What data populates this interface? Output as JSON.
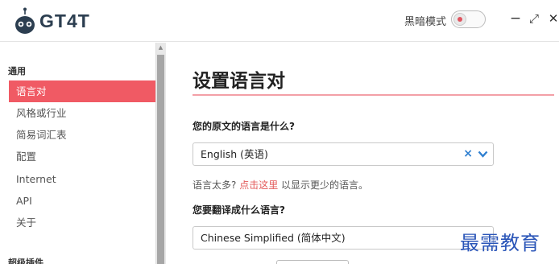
{
  "app": {
    "logo_text": "GT4T"
  },
  "titlebar": {
    "dark_mode_label": "黑暗模式",
    "minimize_glyph": "−",
    "maximize_glyph": "⤢",
    "close_glyph": "✕",
    "accent_color": "#f05a64"
  },
  "sidebar": {
    "group_general": "通用",
    "items": [
      {
        "label": "语言对",
        "active": true
      },
      {
        "label": "风格或行业",
        "active": false
      },
      {
        "label": "简易词汇表",
        "active": false
      },
      {
        "label": "配置",
        "active": false
      },
      {
        "label": "Internet",
        "active": false
      },
      {
        "label": "API",
        "active": false
      },
      {
        "label": "关于",
        "active": false
      }
    ],
    "group_plugins": "超级插件"
  },
  "main": {
    "title": "设置语言对",
    "source_question": "您的原文的语言是什么?",
    "source_value": "English (英语)",
    "hint_prefix": "语言太多?",
    "hint_link": "点击这里",
    "hint_suffix": "以显示更少的语言。",
    "target_question": "您要翻译成什么语言?",
    "target_value": "Chinese Simplified (简体中文)"
  },
  "watermark": {
    "text": "最需教育"
  }
}
